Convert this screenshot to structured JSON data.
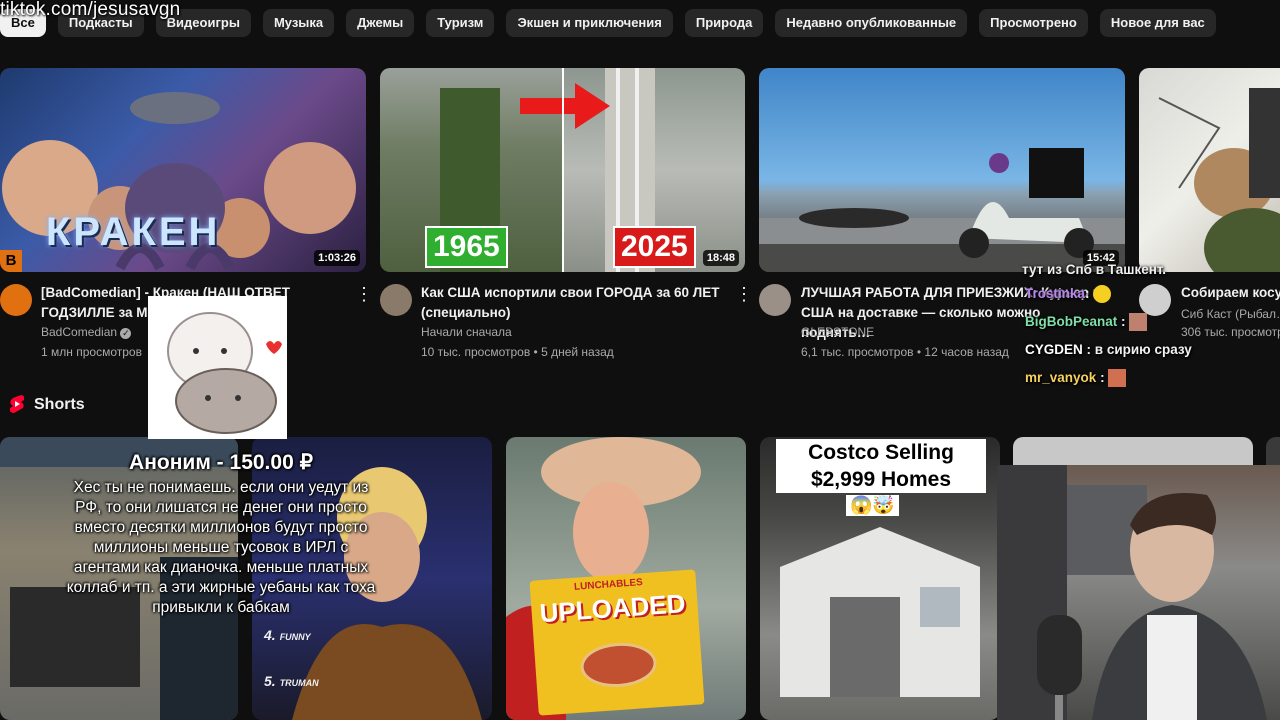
{
  "overlay": {
    "url": "tiktok.com/jesusavgn"
  },
  "chips": [
    "Все",
    "Подкасты",
    "Видеоигры",
    "Музыка",
    "Джемы",
    "Туризм",
    "Экшен и приключения",
    "Природа",
    "Недавно опубликованные",
    "Просмотрено",
    "Новое для вас"
  ],
  "videos": [
    {
      "thumb_text": "КРАКЕН",
      "duration": "1:03:26",
      "title": "[BadComedian] - Кракен (НАШ ОТВЕТ ГОДЗИЛЛЕ за М…",
      "channel": "BadComedian",
      "meta": "1 млн просмотров"
    },
    {
      "thumb_left": "1965",
      "thumb_right": "2025",
      "duration": "18:48",
      "title": "Как США испортили свои ГОРОДА за 60 ЛЕТ (специально)",
      "channel": "Начали сначала",
      "meta": "10 тыс. просмотров • 5 дней назад"
    },
    {
      "duration": "15:42",
      "title": "ЛУЧШАЯ РАБОТА ДЛЯ ПРИЕЗЖИХ: Курьер в США на доставке — сколько можно поднять…",
      "channel": "GLEBSTONE",
      "meta": "6,1 тыс. просмотров • 12 часов назад"
    },
    {
      "title": "Собираем косу…",
      "channel": "Сиб Каст (Рыбал…",
      "meta": "306 тыс. просмотр…"
    }
  ],
  "shorts": {
    "label": "Shorts",
    "items": [
      {
        "ranks": [
          "4.",
          "5."
        ],
        "rank_names": [
          "FUNNY",
          "TRUMAN"
        ]
      },
      {
        "title": "UPLOADED",
        "brand": "LUNCHABLES"
      },
      {
        "caption": "Costco Selling $2,999 Homes",
        "emoji": "😱🤯"
      },
      {}
    ]
  },
  "donation": {
    "header": "Аноним - 150.00 ₽",
    "text": "Хес ты не понимаешь. если они уедут из РФ, то они лишатся не денег они просто вместо десятки миллионов будут просто миллионы меньше тусовок в ИРЛ с агентами как дианочка. меньше платных коллаб и тп. а эти жирные уебаны как тоха привыкли к бабкам"
  },
  "chat": {
    "top_line": "тут из Спб в Ташкент.",
    "messages": [
      {
        "user": "Trostinka",
        "text": ":",
        "color": "#b784f0"
      },
      {
        "user": "BigBobPeanat",
        "text": ":",
        "color": "#7ee0a8"
      },
      {
        "user": "CYGDEN",
        "text": ": в сирию сразу",
        "color": "#ffffff"
      },
      {
        "user": "mr_vanyok",
        "text": ":",
        "color": "#f5d060"
      }
    ]
  },
  "colors": {
    "bg": "#0f0f0f",
    "chip": "#272727",
    "red": "#ff0033"
  }
}
